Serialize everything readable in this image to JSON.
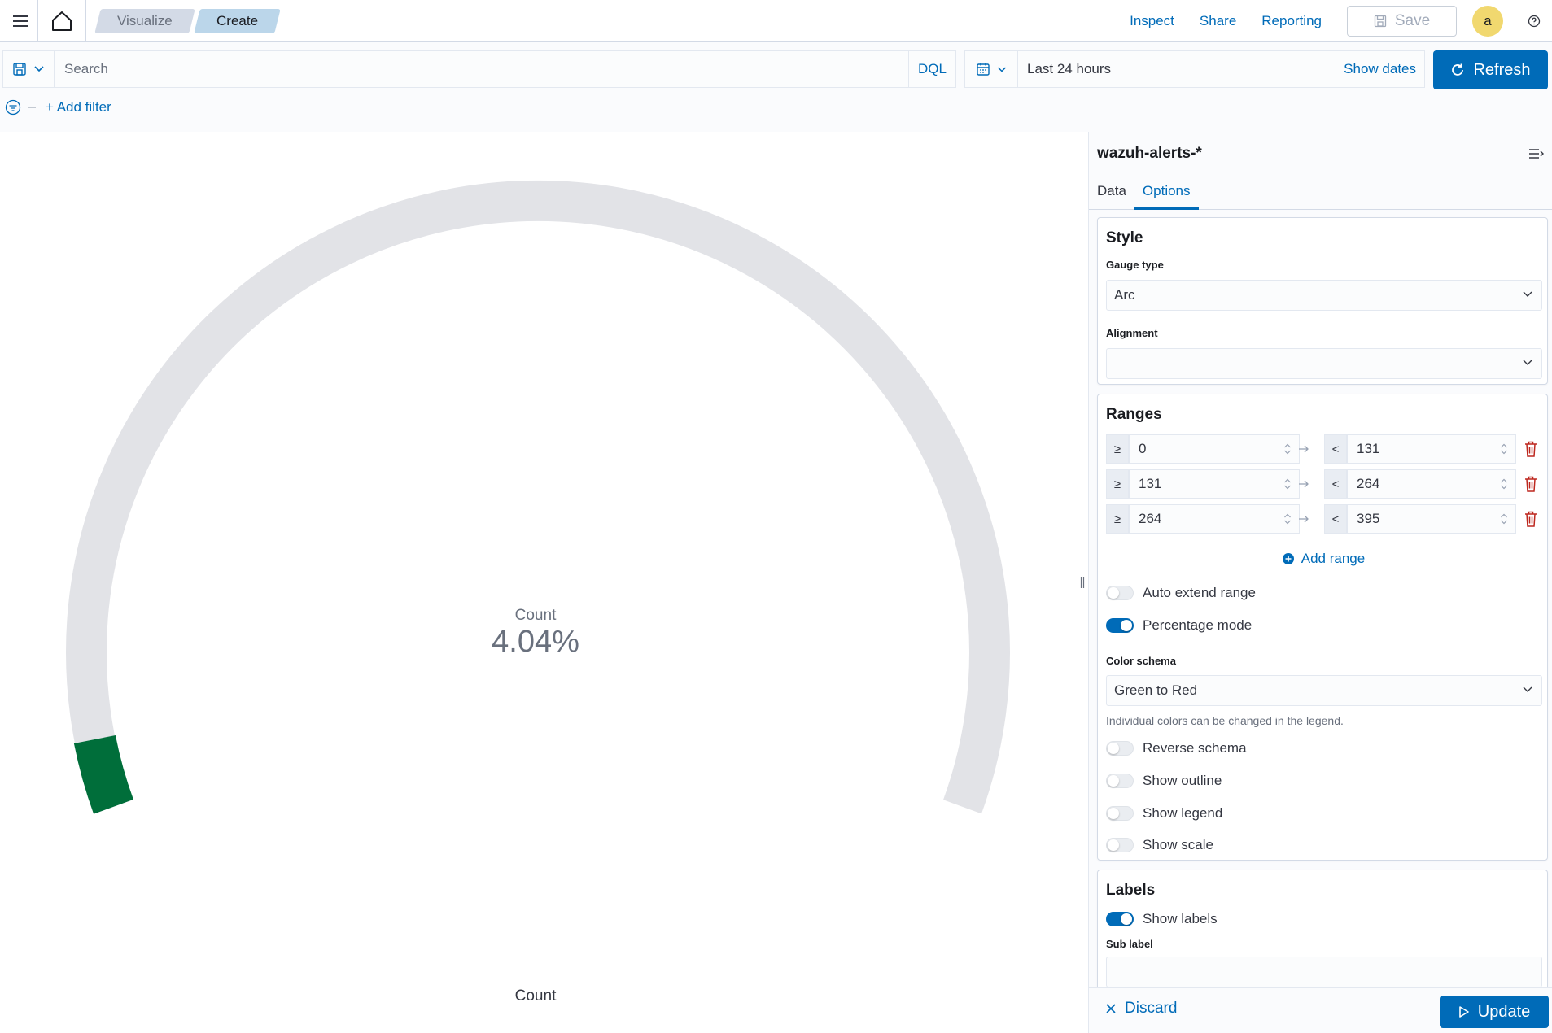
{
  "header": {
    "breadcrumbs": [
      "Visualize",
      "Create"
    ],
    "links": {
      "inspect": "Inspect",
      "share": "Share",
      "reporting": "Reporting"
    },
    "save_label": "Save",
    "avatar_initial": "a"
  },
  "query": {
    "search_placeholder": "Search",
    "language": "DQL",
    "date_range": "Last 24 hours",
    "show_dates": "Show dates",
    "refresh_label": "Refresh",
    "add_filter": "+ Add filter"
  },
  "visualization": {
    "gauge_label": "Count",
    "gauge_value": "4.04%",
    "axis_title": "Count",
    "fill_fraction": 0.0404,
    "fill_color": "#006e3a",
    "track_color": "#e2e3e7"
  },
  "sidebar": {
    "index_pattern": "wazuh-alerts-*",
    "tabs": [
      "Data",
      "Options"
    ],
    "active_tab": "Options",
    "style": {
      "title": "Style",
      "gauge_type_label": "Gauge type",
      "gauge_type_value": "Arc",
      "alignment_label": "Alignment",
      "alignment_value": ""
    },
    "ranges": {
      "title": "Ranges",
      "rows": [
        {
          "from_symbol": "≥",
          "from": "0",
          "to_symbol": "<",
          "to": "131"
        },
        {
          "from_symbol": "≥",
          "from": "131",
          "to_symbol": "<",
          "to": "264"
        },
        {
          "from_symbol": "≥",
          "from": "264",
          "to_symbol": "<",
          "to": "395"
        }
      ],
      "add_range": "Add range",
      "auto_extend": "Auto extend range",
      "percentage_mode": "Percentage mode",
      "color_schema_label": "Color schema",
      "color_schema_value": "Green to Red",
      "color_help": "Individual colors can be changed in the legend.",
      "reverse_schema": "Reverse schema",
      "show_outline": "Show outline",
      "show_legend": "Show legend",
      "show_scale": "Show scale"
    },
    "labels": {
      "title": "Labels",
      "show_labels": "Show labels",
      "sub_label": "Sub label"
    },
    "footer": {
      "discard": "Discard",
      "update": "Update"
    }
  },
  "colors": {
    "primary": "#006bb8",
    "danger": "#bd271e"
  }
}
